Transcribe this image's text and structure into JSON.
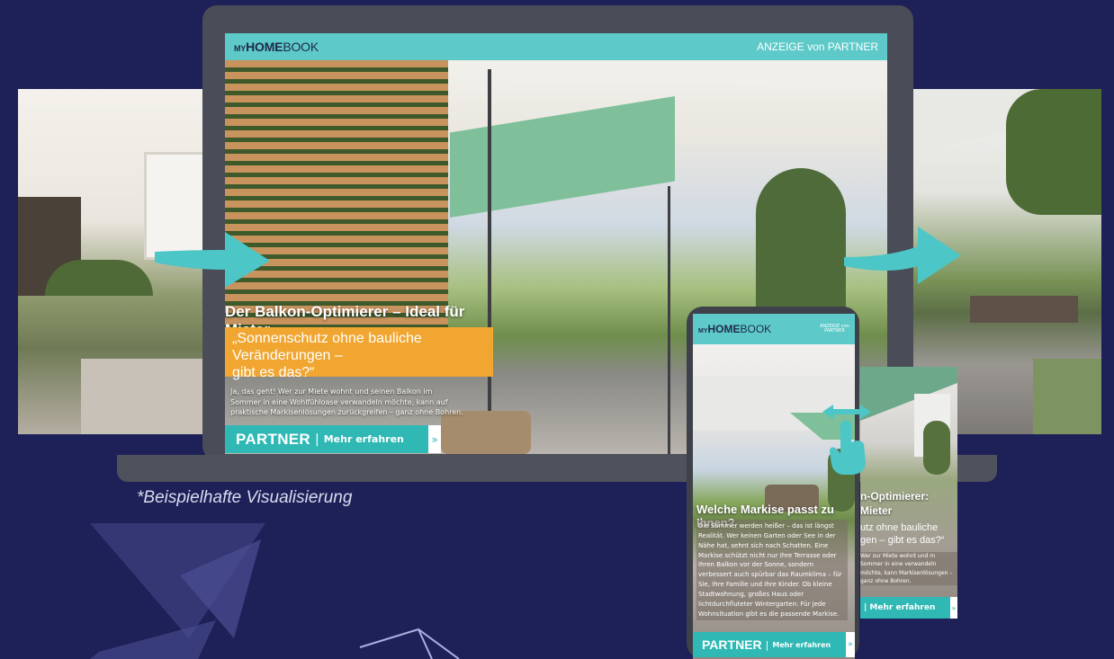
{
  "laptop": {
    "logo_my": "MY",
    "logo_home": "HOME",
    "logo_book": "BOOK",
    "ad_label": "ANZEIGE von PARTNER",
    "headline": "Der Balkon-Optimierer – Ideal für Mieter",
    "quote_line1": "„Sonnenschutz ohne bauliche Veränderungen –",
    "quote_line2": "gibt es das?“",
    "body": "Ja, das geht! Wer zur Miete wohnt und seinen Balkon im Sommer in eine Wohlfühloase verwandeln möchte, kann auf praktische Markisenlösungen zurückgreifen – ganz ohne Bohren.",
    "cta_brand": "PARTNER",
    "cta_sep": "|",
    "cta_more": "Mehr erfahren",
    "cta_arrow": "»"
  },
  "footnote": "*Beispielhafte Visualisierung",
  "phone": {
    "logo_my": "MY",
    "logo_home": "HOME",
    "logo_book": "BOOK",
    "ad_label_line1": "ANZEIGE von",
    "ad_label_line2": "PARTNER",
    "fullscreen_glyph": "⛶",
    "headline": "Welche Markise passt zu Ihnen?",
    "body": "Die Sommer werden heißer – das ist längst Realität. Wer keinen Garten oder See in der Nähe hat, sehnt sich nach Schatten. Eine Markise schützt nicht nur Ihre Terrasse oder Ihren Balkon vor der Sonne, sondern verbessert auch spürbar das Raumklima – für Sie, Ihre Familie und Ihre Kinder. Ob kleine Stadtwohnung, großes Haus oder lichtdurchfluteter Wintergarten: Für jede Wohnsituation gibt es die passende Markise.",
    "cta_brand": "PARTNER",
    "cta_sep": "|",
    "cta_more": "Mehr erfahren",
    "cta_arrow": "»"
  },
  "back_phone": {
    "headline_line1": "n-Optimierer:",
    "headline_line2": "Mieter",
    "quote_line1": "utz ohne bauliche",
    "quote_line2": "gen – gibt es das?“",
    "body": "Wer zur Miete wohnt und m Sommer in eine verwandeln möchte, kann Markisenlösungen – ganz ohne Bohren.",
    "cta_more": "| Mehr erfahren",
    "cta_arrow": "»"
  },
  "colors": {
    "background": "#1e2158",
    "teal": "#5ec9c9",
    "cta_teal": "#2fb8b4",
    "orange": "#f0a631",
    "device": "#4a4d57"
  },
  "icons": [
    "arrow-right-icon",
    "swipe-hand-icon",
    "fullscreen-icon",
    "chevron-double-right-icon"
  ]
}
